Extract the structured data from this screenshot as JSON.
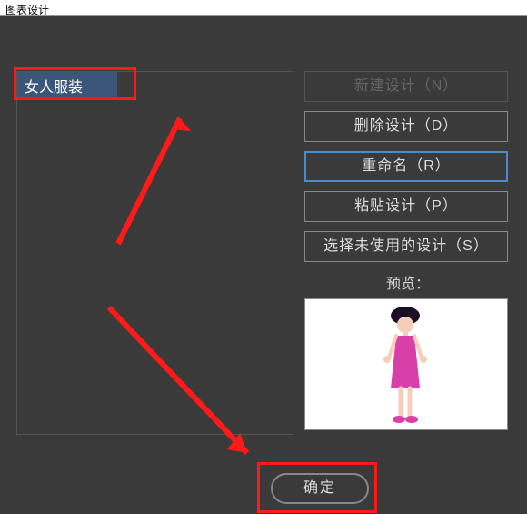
{
  "window": {
    "title": "图表设计"
  },
  "list": {
    "selected": "女人服装"
  },
  "buttons": {
    "new_design": "新建设计（N）",
    "delete_design": "删除设计（D）",
    "rename": "重命名（R）",
    "paste_design": "粘贴设计（P）",
    "select_unused": "选择未使用的设计（S）"
  },
  "preview": {
    "label": "预览："
  },
  "ok": "确定"
}
